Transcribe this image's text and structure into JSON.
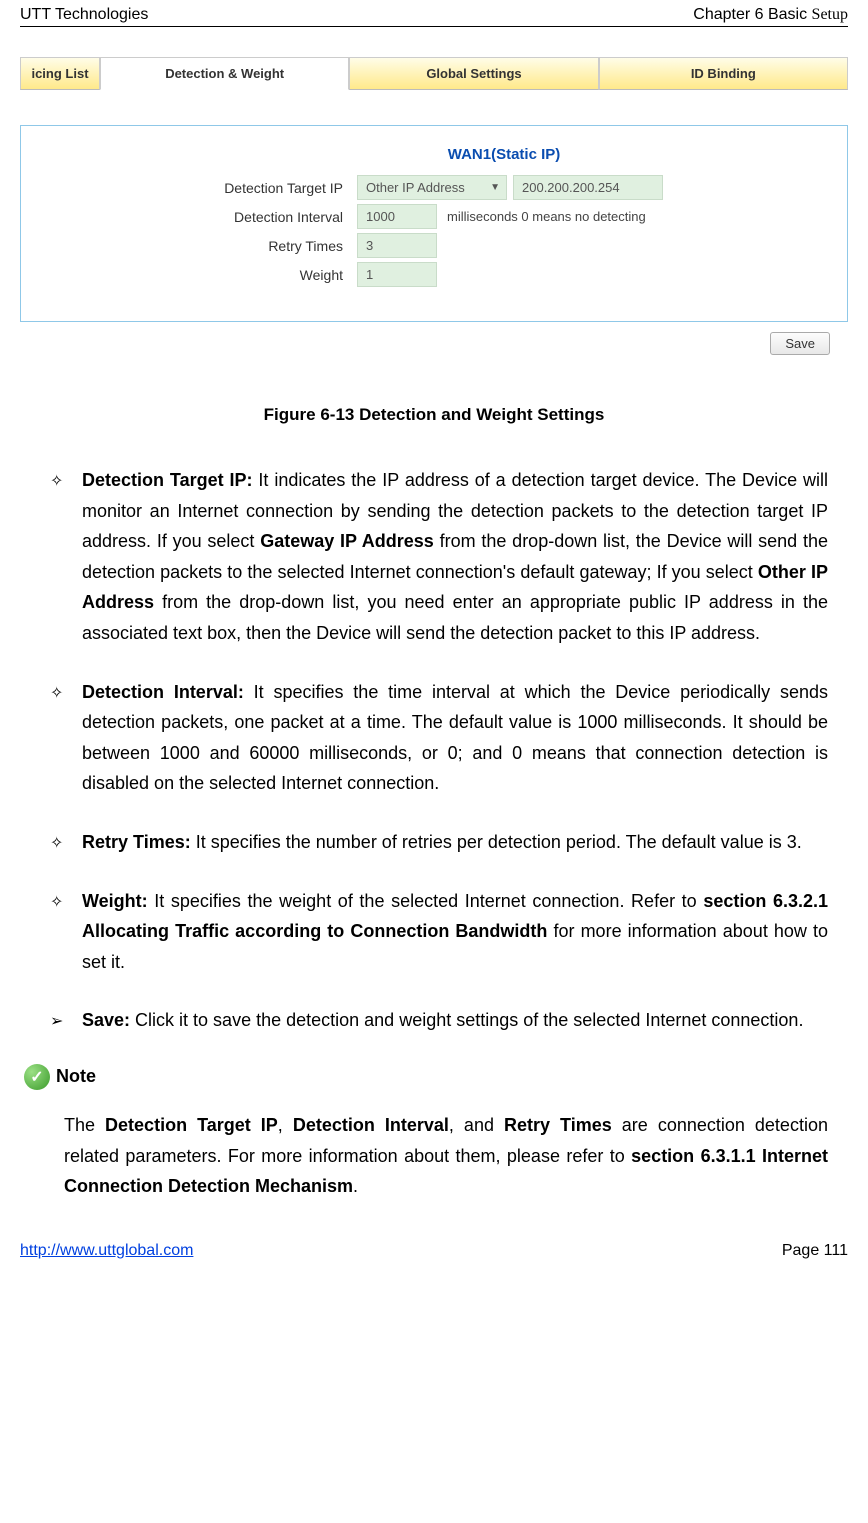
{
  "header": {
    "left": "UTT Technologies",
    "right_chapter": "Chapter 6 Basic ",
    "right_setup": "Setup"
  },
  "tabs": {
    "t0": "icing List",
    "t1": "Detection & Weight",
    "t2": "Global Settings",
    "t3": "ID Binding"
  },
  "form": {
    "legend": "WAN1(Static IP)",
    "label_target": "Detection Target IP",
    "select_value": "Other IP Address",
    "ip_value": "200.200.200.254",
    "label_interval": "Detection Interval",
    "interval_value": "1000",
    "interval_hint": "milliseconds 0 means no detecting",
    "label_retry": "Retry Times",
    "retry_value": "3",
    "label_weight": "Weight",
    "weight_value": "1",
    "save": "Save"
  },
  "figure_caption": "Figure 6-13 Detection and Weight Settings",
  "bullets": {
    "diamond": "✧",
    "arrow": "➢"
  },
  "items": {
    "i1": {
      "head": "Detection Target IP:",
      "rest_a": " It indicates the IP address of a detection target device. The Device will monitor an Internet connection by sending the detection packets to the detection target IP address. If you select ",
      "bold_a": "Gateway IP Address",
      "rest_b": " from the drop-down list, the Device will send the detection packets to the selected Internet connection's default gateway; If you select ",
      "bold_b": "Other IP Address",
      "rest_c": " from the drop-down list, you need enter an appropriate public IP address in the associated text box, then the Device will send the detection packet to this IP address."
    },
    "i2": {
      "head": "Detection Interval:",
      "rest": " It specifies the time interval at which the Device periodically sends detection packets, one packet at a time. The default value is 1000 milliseconds. It should be between 1000 and 60000 milliseconds, or 0; and 0 means that connection detection is disabled on the selected Internet connection."
    },
    "i3": {
      "head": "Retry Times:",
      "rest": " It specifies the number of retries per detection period. The default value is 3."
    },
    "i4": {
      "head": "Weight:",
      "rest_a": " It specifies the weight of the selected Internet connection. Refer to ",
      "bold": "section 6.3.2.1 Allocating Traffic according to Connection Bandwidth",
      "rest_b": " for more information about how to set it."
    },
    "i5": {
      "head": "Save:",
      "rest": " Click it to save the detection and weight settings of the selected Internet connection."
    }
  },
  "note": {
    "label": "Note",
    "a": "The ",
    "b1": "Detection Target IP",
    "c": ", ",
    "b2": "Detection Interval",
    "d": ", and ",
    "b3": "Retry Times",
    "e": " are connection detection related parameters. For more information about them, please refer to ",
    "b4": "section 6.3.1.1 Internet Connection Detection Mechanism",
    "f": "."
  },
  "footer": {
    "link": "http://www.uttglobal.com",
    "page": "Page 111"
  }
}
